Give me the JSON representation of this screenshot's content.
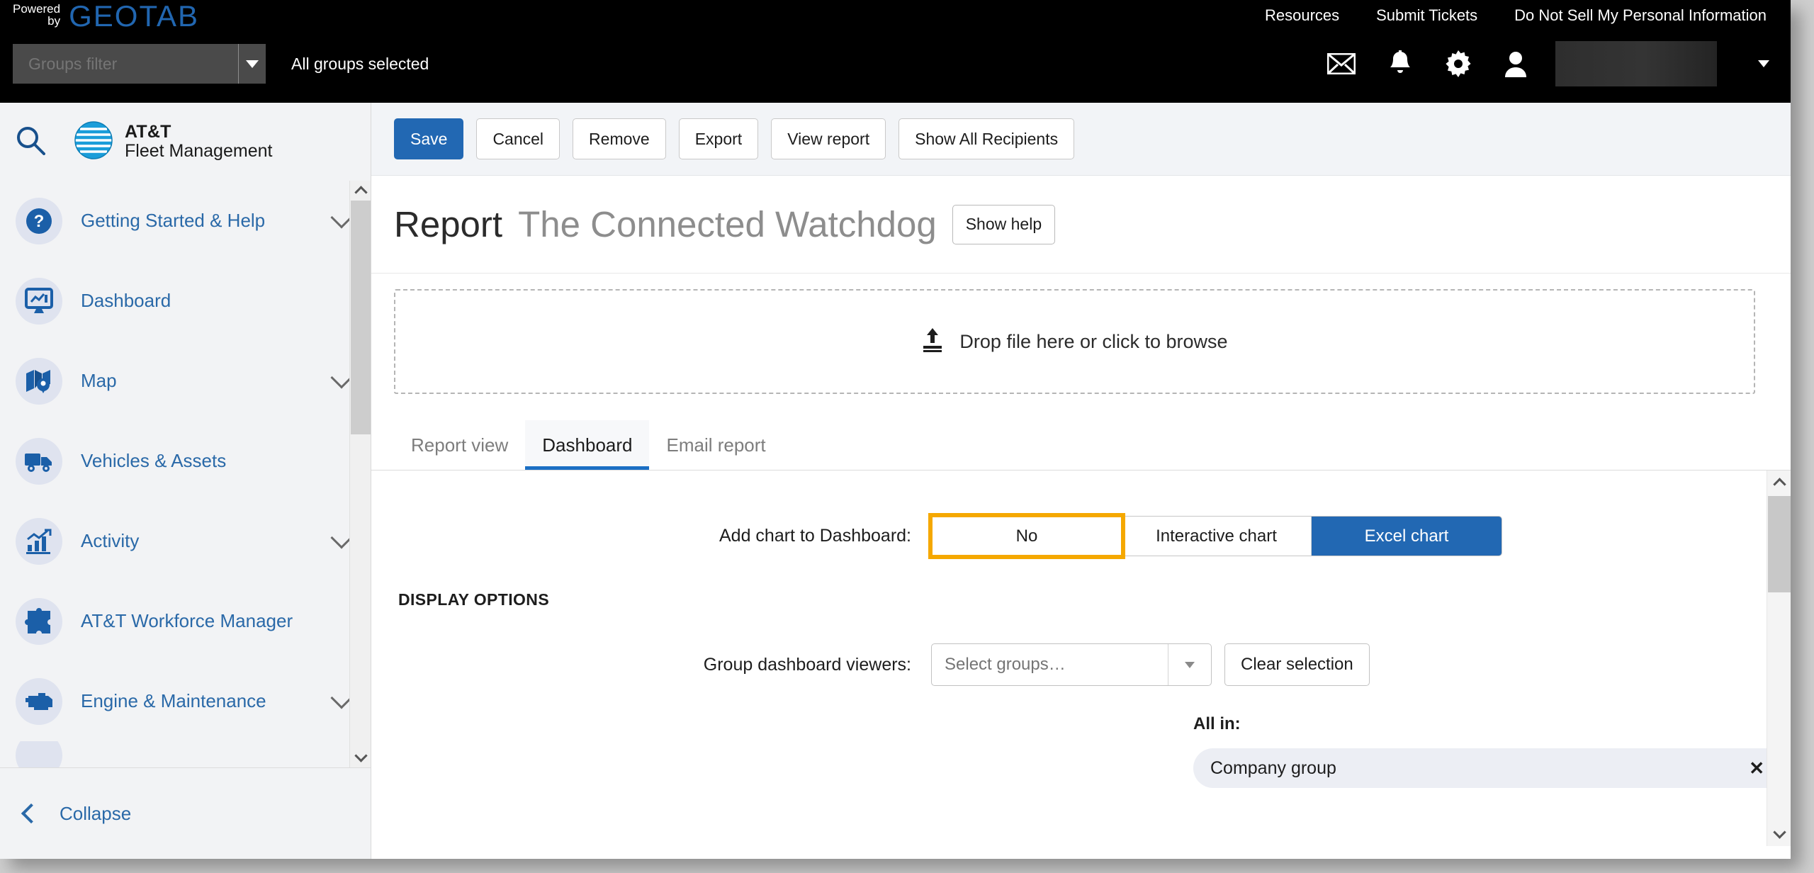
{
  "topbar": {
    "powered_line1": "Powered",
    "powered_line2": "by",
    "brand": "GEOTAB",
    "links": [
      {
        "label": "Resources"
      },
      {
        "label": "Submit Tickets"
      },
      {
        "label": "Do Not Sell My Personal Information"
      }
    ],
    "groups_filter_placeholder": "Groups filter",
    "groups_filter_value": "",
    "groups_status": "All groups selected",
    "icons": [
      {
        "name": "mail-icon"
      },
      {
        "name": "bell-icon"
      },
      {
        "name": "gear-icon"
      },
      {
        "name": "user-icon"
      }
    ],
    "user_name": ""
  },
  "sidebar": {
    "search_placeholder": "",
    "product_line1": "AT&T",
    "product_line2": "Fleet Management",
    "items": [
      {
        "label": "Getting Started & Help",
        "icon": "question-circle-icon",
        "expandable": true
      },
      {
        "label": "Dashboard",
        "icon": "dashboard-monitor-icon",
        "expandable": false
      },
      {
        "label": "Map",
        "icon": "map-pin-icon",
        "expandable": true
      },
      {
        "label": "Vehicles & Assets",
        "icon": "truck-icon",
        "expandable": false
      },
      {
        "label": "Activity",
        "icon": "bar-chart-icon",
        "expandable": true
      },
      {
        "label": "AT&T Workforce Manager",
        "icon": "puzzle-piece-icon",
        "expandable": false
      },
      {
        "label": "Engine & Maintenance",
        "icon": "engine-icon",
        "expandable": true
      }
    ],
    "collapse_label": "Collapse"
  },
  "toolbar": {
    "buttons": [
      {
        "label": "Save",
        "style": "primary"
      },
      {
        "label": "Cancel",
        "style": "default"
      },
      {
        "label": "Remove",
        "style": "default"
      },
      {
        "label": "Export",
        "style": "default"
      },
      {
        "label": "View report",
        "style": "default"
      },
      {
        "label": "Show All Recipients",
        "style": "default"
      }
    ]
  },
  "page": {
    "title_main": "Report",
    "title_sub": "The Connected Watchdog",
    "help_button": "Show help",
    "dropzone_text": "Drop file here or click to browse",
    "dropzone_icon": "upload-icon"
  },
  "tabs": [
    {
      "label": "Report view",
      "active": false
    },
    {
      "label": "Dashboard",
      "active": true
    },
    {
      "label": "Email report",
      "active": false
    }
  ],
  "form": {
    "add_chart_label": "Add chart to Dashboard:",
    "chart_options": [
      {
        "label": "No",
        "state": "focused"
      },
      {
        "label": "Interactive chart",
        "state": "normal"
      },
      {
        "label": "Excel chart",
        "state": "selected"
      }
    ],
    "display_options_heading": "DISPLAY OPTIONS",
    "group_viewers_label": "Group dashboard viewers:",
    "group_viewers_placeholder": "Select groups…",
    "group_viewers_value": "",
    "clear_selection_label": "Clear selection",
    "all_in_label": "All in:",
    "chips": [
      {
        "label": "Company group",
        "remove_icon": "close-icon"
      }
    ]
  },
  "colors": {
    "accent_blue": "#2268b3",
    "focus_orange": "#f5a800",
    "geotab_blue": "#2166b0",
    "sidebar_link": "#2a69a8",
    "topbar_black": "#000000"
  }
}
